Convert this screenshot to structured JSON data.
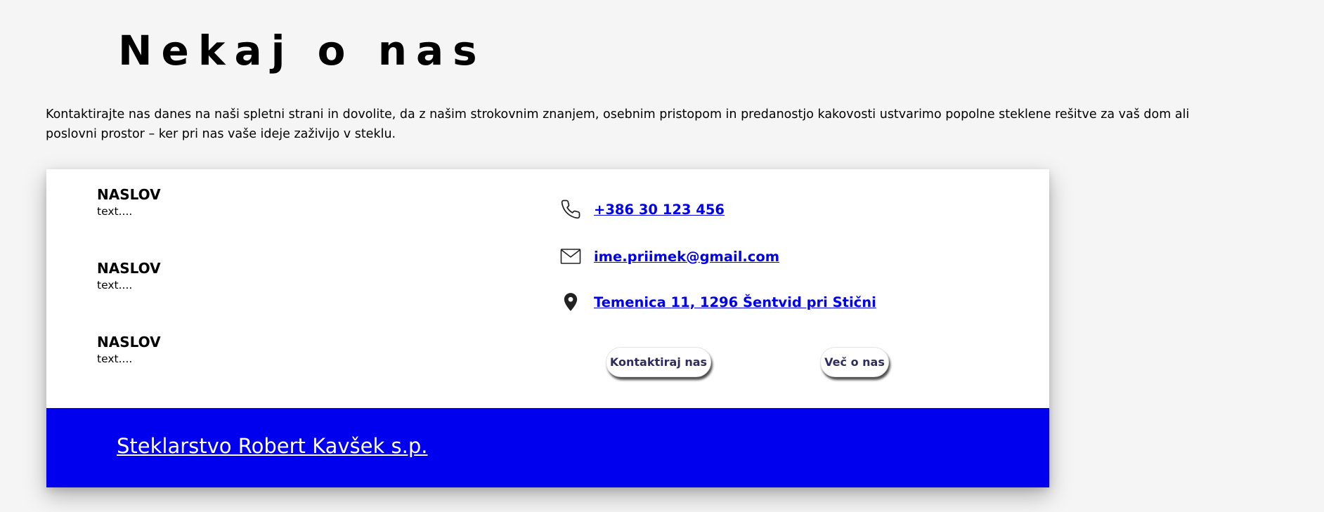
{
  "section": {
    "title": "Nekaj o nas",
    "intro": "Kontaktirajte nas danes na naši spletni strani in dovolite, da z našim strokovnim znanjem, osebnim pristopom in predanostjo kakovosti ustvarimo popolne steklene rešitve za vaš dom ali poslovni prostor – ker pri nas vaše ideje zaživijo v steklu."
  },
  "info": [
    {
      "title": "NASLOV",
      "text": "text...."
    },
    {
      "title": "NASLOV",
      "text": "text...."
    },
    {
      "title": "NASLOV",
      "text": "text...."
    }
  ],
  "contact": {
    "phone": {
      "icon": "phone-icon",
      "label": "+386 30 123 456"
    },
    "email": {
      "icon": "mail-icon",
      "label": "ime.priimek@gmail.com"
    },
    "address": {
      "icon": "location-pin-icon",
      "label": "Temenica 11, 1296 Šentvid pri Stični"
    }
  },
  "buttons": {
    "contact_label": "Kontaktiraj nas",
    "more_label": "Več o nas"
  },
  "footer": {
    "company_link": "Steklarstvo Robert Kavšek s.p."
  },
  "colors": {
    "page_background": "#f5f5f5",
    "card_background": "#ffffff",
    "link": "#0000ee",
    "footer_band": "#0000ee",
    "button_text": "#2e2c5c"
  }
}
